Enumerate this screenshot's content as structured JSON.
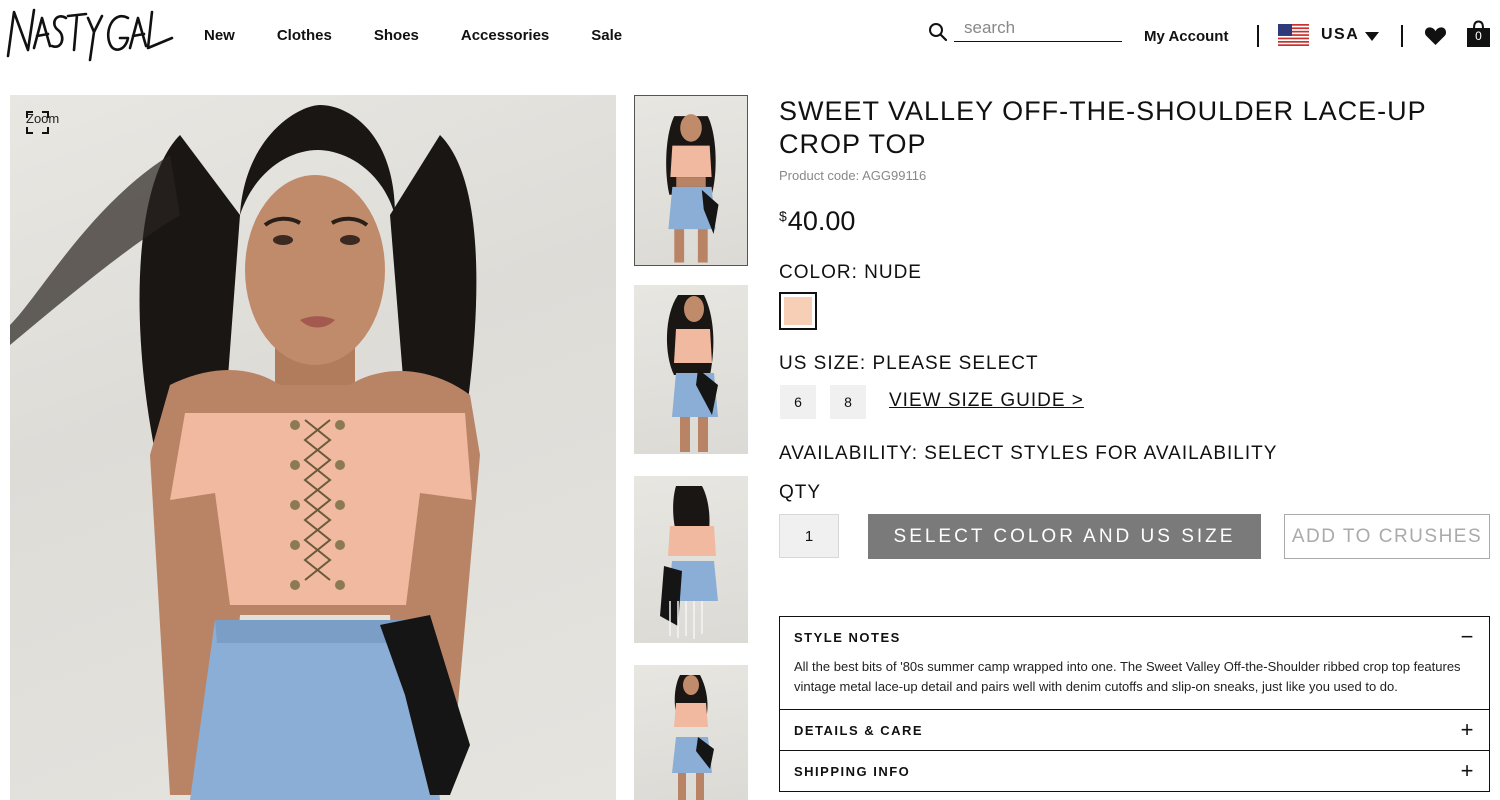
{
  "brand": {
    "name": "NASTY GAL"
  },
  "nav": {
    "items": [
      "New",
      "Clothes",
      "Shoes",
      "Accessories",
      "Sale"
    ]
  },
  "search": {
    "placeholder": "search"
  },
  "account": {
    "label": "My Account"
  },
  "country": {
    "code": "USA",
    "flag_icon": "us-flag-icon"
  },
  "bag": {
    "count": "0"
  },
  "gallery": {
    "zoom_label": "Zoom",
    "thumbnails": [
      "front view",
      "side view",
      "back view",
      "full length view"
    ]
  },
  "product": {
    "title": "SWEET VALLEY OFF-THE-SHOULDER LACE-UP CROP TOP",
    "code": "Product code: AGG99116",
    "price_currency": "$",
    "price_amount": "40.00",
    "color_label": "COLOR: NUDE",
    "color_hex": "#f7cfb6",
    "size_label": "US SIZE: PLEASE SELECT",
    "sizes": [
      "6",
      "8"
    ],
    "size_guide": "VIEW SIZE GUIDE >",
    "availability": "AVAILABILITY: SELECT STYLES FOR AVAILABILITY",
    "qty_label": "QTY",
    "qty_value": "1",
    "add_button": "SELECT COLOR AND US SIZE",
    "crush_button": "ADD TO CRUSHES"
  },
  "accordion": [
    {
      "title": "STYLE NOTES",
      "toggle": "−",
      "body": "All the best bits of '80s summer camp wrapped into one. The Sweet Valley Off-the-Shoulder ribbed crop top features vintage metal lace-up detail and pairs well with denim cutoffs and slip-on sneaks, just like you used to do."
    },
    {
      "title": "DETAILS & CARE",
      "toggle": "+"
    },
    {
      "title": "SHIPPING INFO",
      "toggle": "+"
    }
  ],
  "colors": {
    "button_disabled": "#7a7a7a",
    "swatch_nude": "#f7cfb6",
    "text": "#111111"
  }
}
